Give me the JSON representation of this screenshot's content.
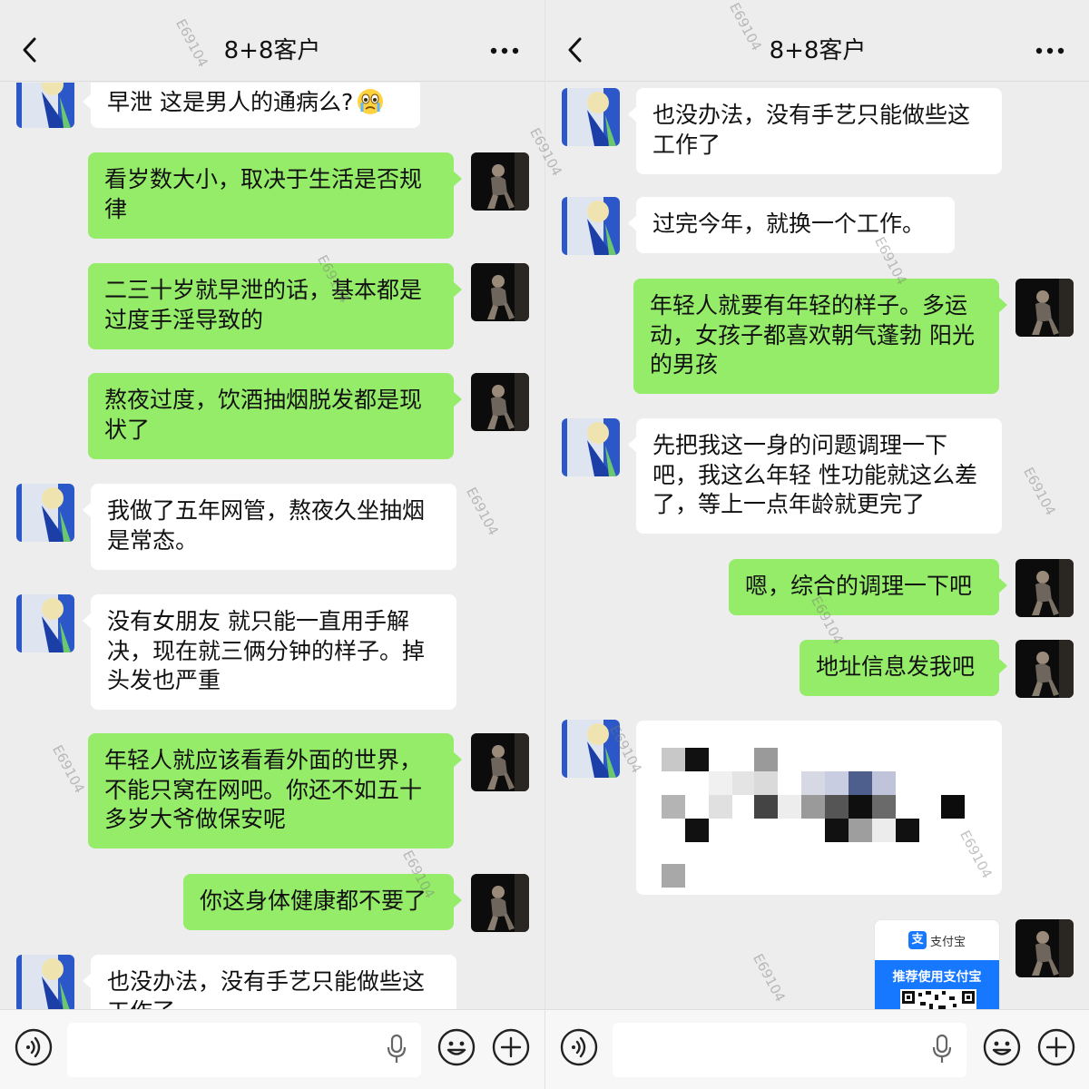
{
  "colors": {
    "background": "#ededed",
    "outgoing_bubble": "#95ec69",
    "incoming_bubble": "#ffffff",
    "alipay_blue": "#1677ff"
  },
  "icons": {
    "back": "chevron-left-icon",
    "more": "more-dots-icon",
    "voice": "voice-mode-icon",
    "mic": "microphone-icon",
    "emoji": "emoji-icon",
    "plus": "plus-icon",
    "crying": "crying-face-emoji"
  },
  "watermark": "E69104",
  "left": {
    "title": "8+8客户",
    "messages": [
      {
        "side": "in",
        "text": "早泄 这是男人的通病么?"
      },
      {
        "side": "out",
        "text": "看岁数大小，取决于生活是否规律"
      },
      {
        "side": "out",
        "text": "二三十岁就早泄的话，基本都是过度手淫导致的"
      },
      {
        "side": "out",
        "text": "熬夜过度，饮酒抽烟脱发都是现状了"
      },
      {
        "side": "in",
        "text": "我做了五年网管，熬夜久坐抽烟是常态。"
      },
      {
        "side": "in",
        "text": "没有女朋友 就只能一直用手解决，现在就三俩分钟的样子。掉头发也严重"
      },
      {
        "side": "out",
        "text": "年轻人就应该看看外面的世界，不能只窝在网吧。你还不如五十多岁大爷做保安呢"
      },
      {
        "side": "out",
        "text": "你这身体健康都不要了"
      },
      {
        "side": "in",
        "text": "也没办法，没有手艺只能做些这工作了"
      }
    ]
  },
  "right": {
    "title": "8+8客户",
    "messages": [
      {
        "side": "in",
        "text": "也没办法，没有手艺只能做些这工作了"
      },
      {
        "side": "in",
        "text": "过完今年，就换一个工作。"
      },
      {
        "side": "out",
        "text": "年轻人就要有年轻的样子。多运动，女孩子都喜欢朝气蓬勃 阳光的男孩"
      },
      {
        "side": "in",
        "text": "先把我这一身的问题调理一下吧，我这么年轻 性功能就这么差了，等上一点年龄就更完了"
      },
      {
        "side": "out",
        "text": "嗯，综合的调理一下吧"
      },
      {
        "side": "out",
        "text": "地址信息发我吧"
      }
    ],
    "pay_card": {
      "brand": "支付宝",
      "tagline": "推荐使用支付宝"
    }
  }
}
